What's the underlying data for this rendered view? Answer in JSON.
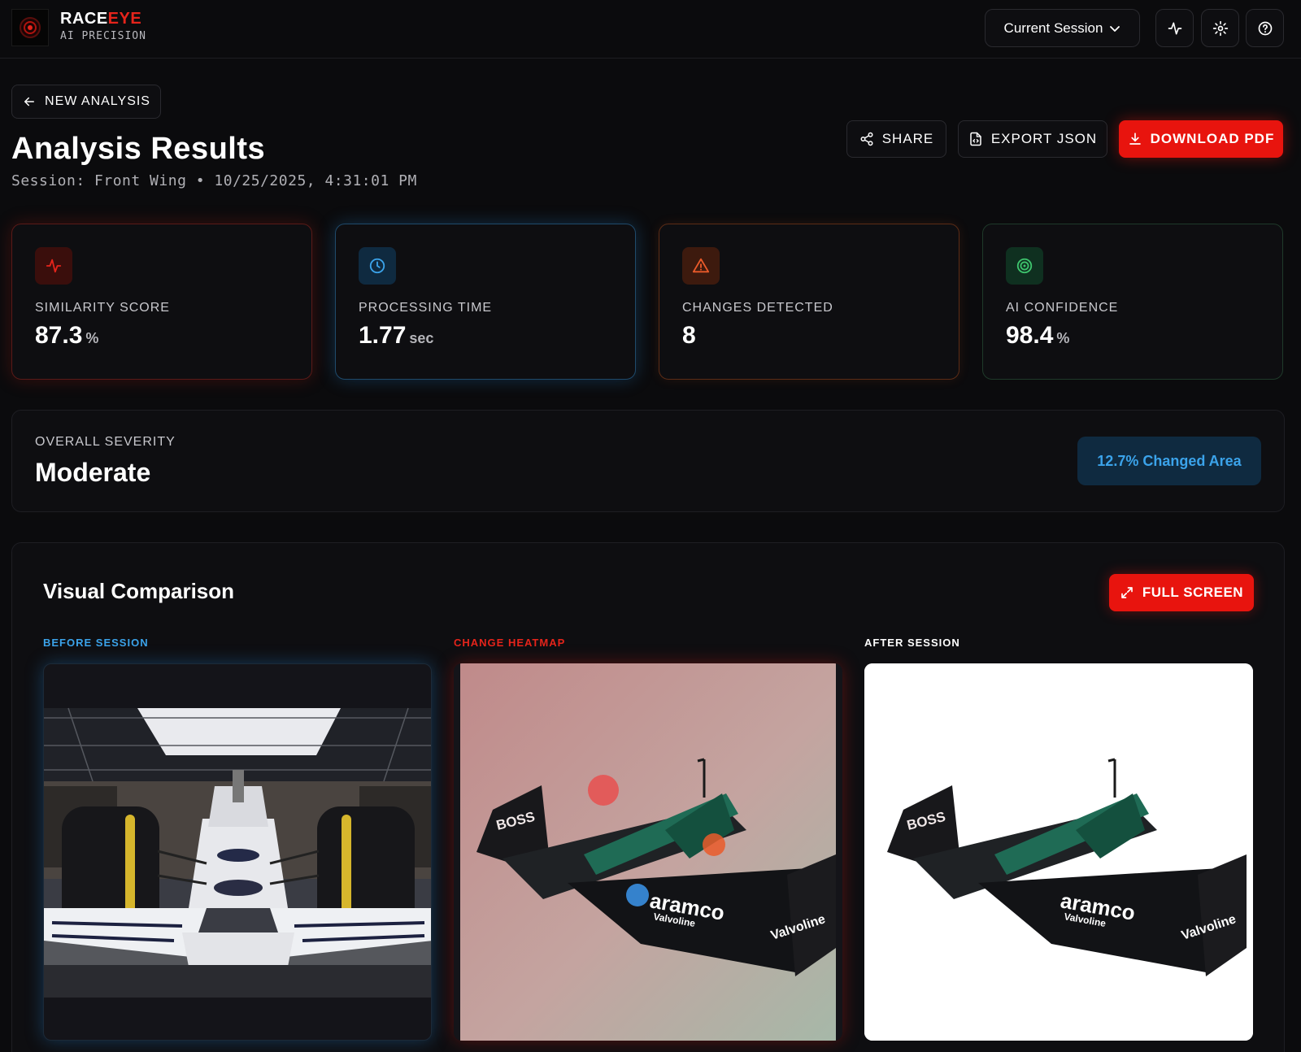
{
  "app": {
    "brand_main": "RACE",
    "brand_accent": "EYE",
    "brand_sub": "AI PRECISION",
    "session_select": "Current Session",
    "icons": [
      "activity-icon",
      "settings-icon",
      "help-icon"
    ]
  },
  "header": {
    "back_label": "NEW ANALYSIS",
    "title": "Analysis Results",
    "session_line": "Session: Front Wing • 10/25/2025, 4:31:01 PM",
    "share_label": "SHARE",
    "export_label": "EXPORT JSON",
    "download_label": "DOWNLOAD PDF"
  },
  "stats": [
    {
      "label": "SIMILARITY SCORE",
      "value": "87.3",
      "unit": "%",
      "icon": "activity-icon",
      "color": "#e5241b"
    },
    {
      "label": "PROCESSING TIME",
      "value": "1.77",
      "unit": "sec",
      "icon": "clock-icon",
      "color": "#3ba3ea"
    },
    {
      "label": "CHANGES DETECTED",
      "value": "8",
      "unit": "",
      "icon": "warning-icon",
      "color": "#ea5a2a"
    },
    {
      "label": "AI CONFIDENCE",
      "value": "98.4",
      "unit": "%",
      "icon": "target-icon",
      "color": "#3ec46d"
    }
  ],
  "severity": {
    "label": "OVERALL SEVERITY",
    "value": "Moderate",
    "badge": "12.7% Changed Area"
  },
  "comparison": {
    "title": "Visual Comparison",
    "fullscreen_label": "FULL SCREEN",
    "before_label": "BEFORE SESSION",
    "heatmap_label": "CHANGE HEATMAP",
    "after_label": "AFTER SESSION",
    "sponsor_boss": "BOSS",
    "sponsor_aramco": "aramco",
    "sponsor_valvoline": "Valvoline"
  },
  "colors": {
    "accent_red": "#e8140e",
    "accent_blue": "#3ba3ea",
    "accent_green": "#3ec46d",
    "accent_orange": "#ea5a2a",
    "background": "#0b0b0d"
  }
}
